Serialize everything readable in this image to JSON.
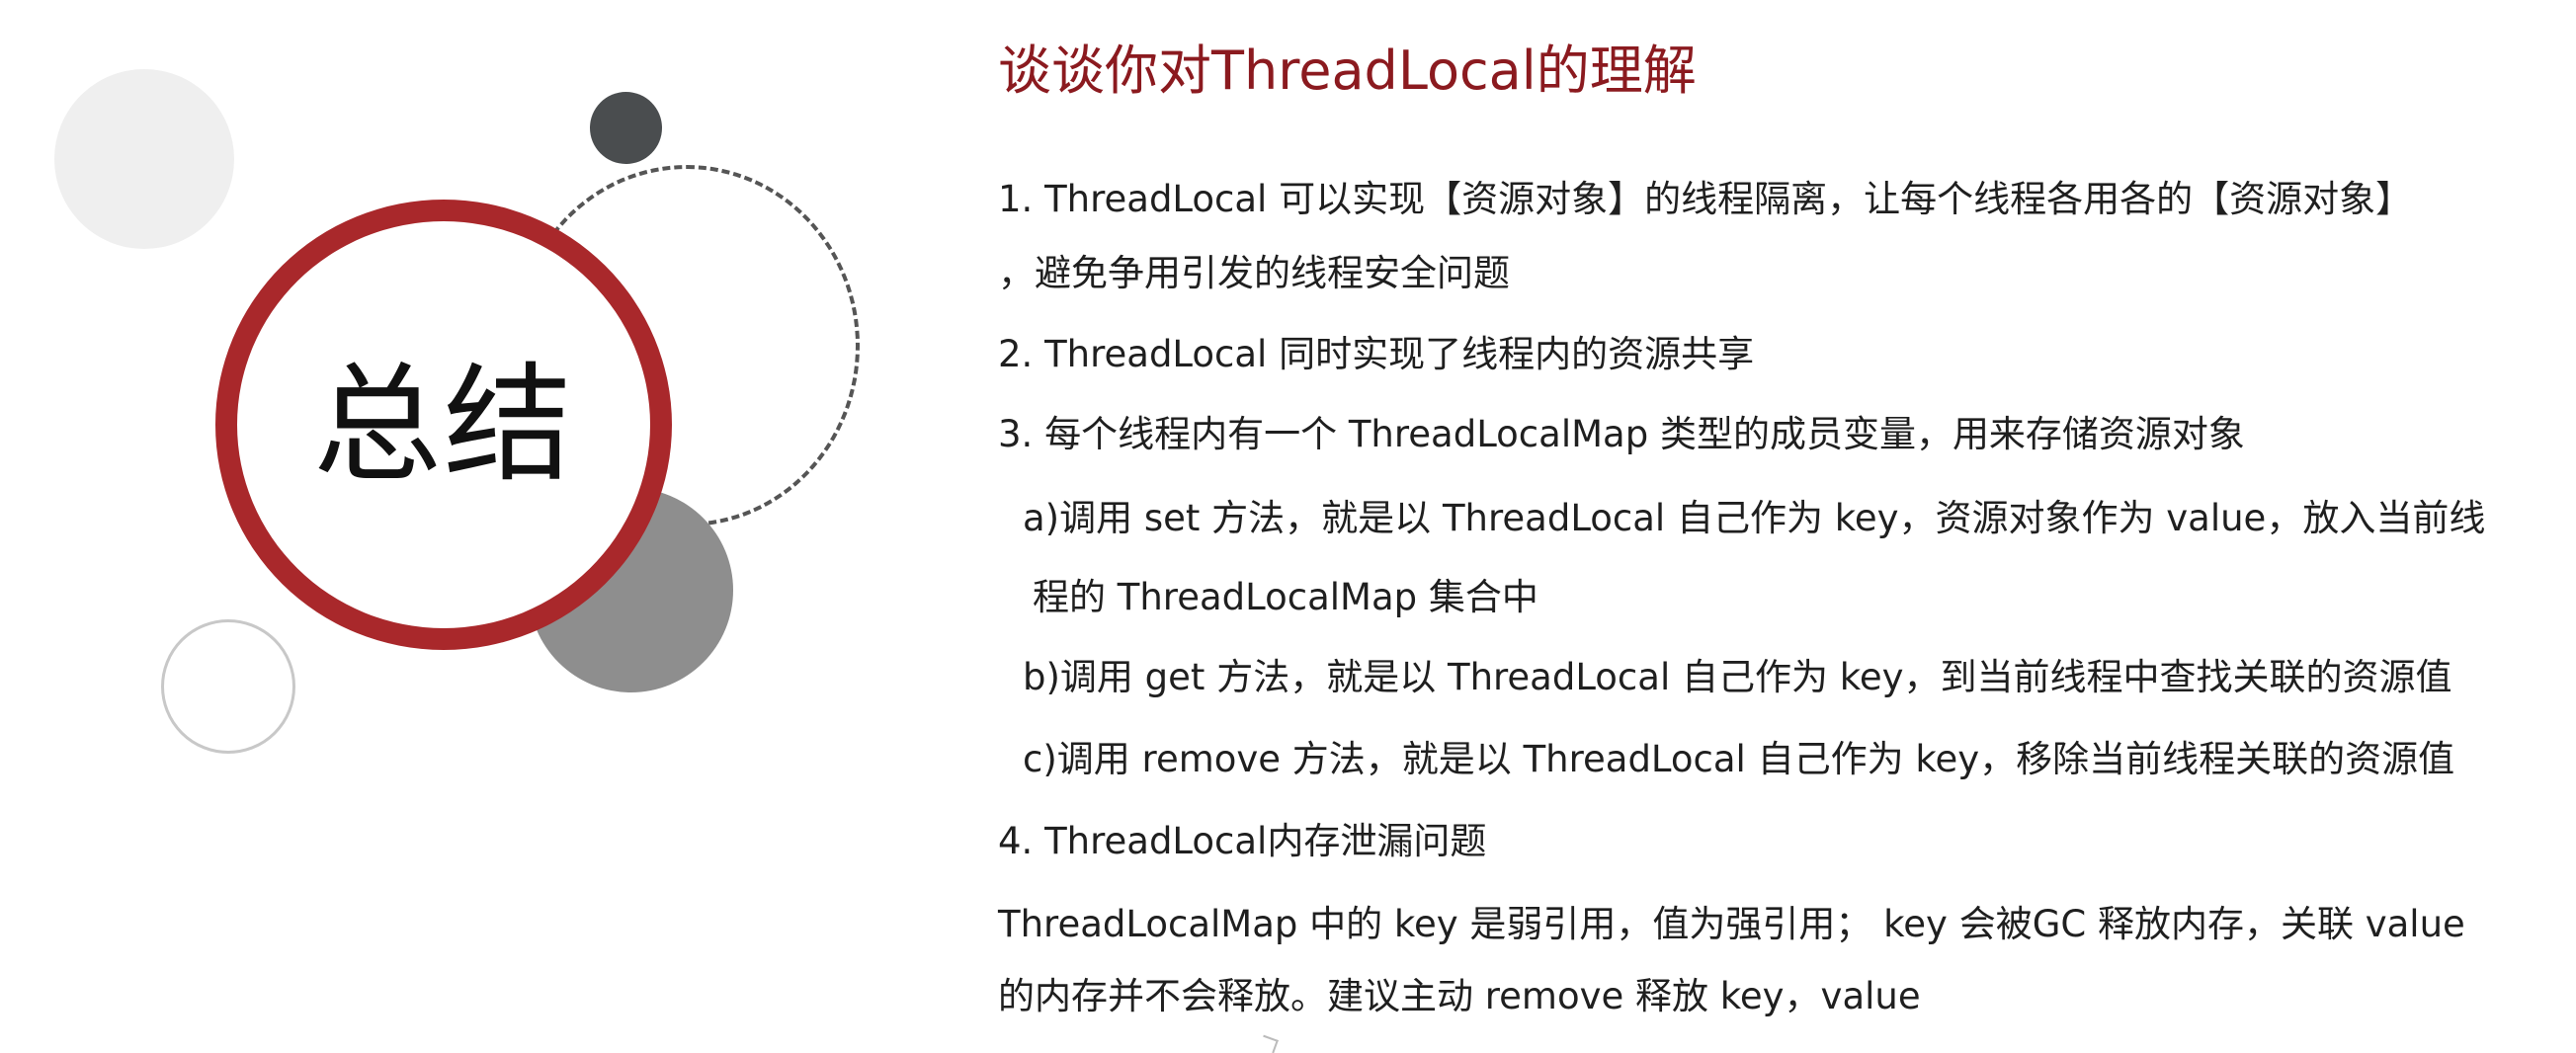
{
  "slide": {
    "summary_label": "总结",
    "title": "谈谈你对ThreadLocal的理解",
    "lines": [
      "1. ThreadLocal 可以实现【资源对象】的线程隔离，让每个线程各用各的【资源对象】",
      "，避免争用引发的线程安全问题",
      "2. ThreadLocal 同时实现了线程内的资源共享",
      "3. 每个线程内有一个 ThreadLocalMap 类型的成员变量，用来存储资源对象",
      "a)调用 set 方法，就是以 ThreadLocal 自己作为 key，资源对象作为 value，放入当前线",
      "程的 ThreadLocalMap 集合中",
      "b)调用 get 方法，就是以 ThreadLocal 自己作为 key，到当前线程中查找关联的资源值",
      "c)调用 remove 方法，就是以 ThreadLocal 自己作为 key，移除当前线程关联的资源值",
      "4. ThreadLocal内存泄漏问题",
      "ThreadLocalMap 中的 key 是弱引用，值为强引用； key 会被GC 释放内存，关联 value",
      "的内存并不会释放。建议主动 remove 释放 key，value"
    ]
  },
  "colors": {
    "accent_red": "#a9282b",
    "title_red": "#8b1a1f",
    "dark_circle": "#4a4d4f",
    "gray_circle": "#8e8e8e",
    "light_circle": "#efefef"
  }
}
